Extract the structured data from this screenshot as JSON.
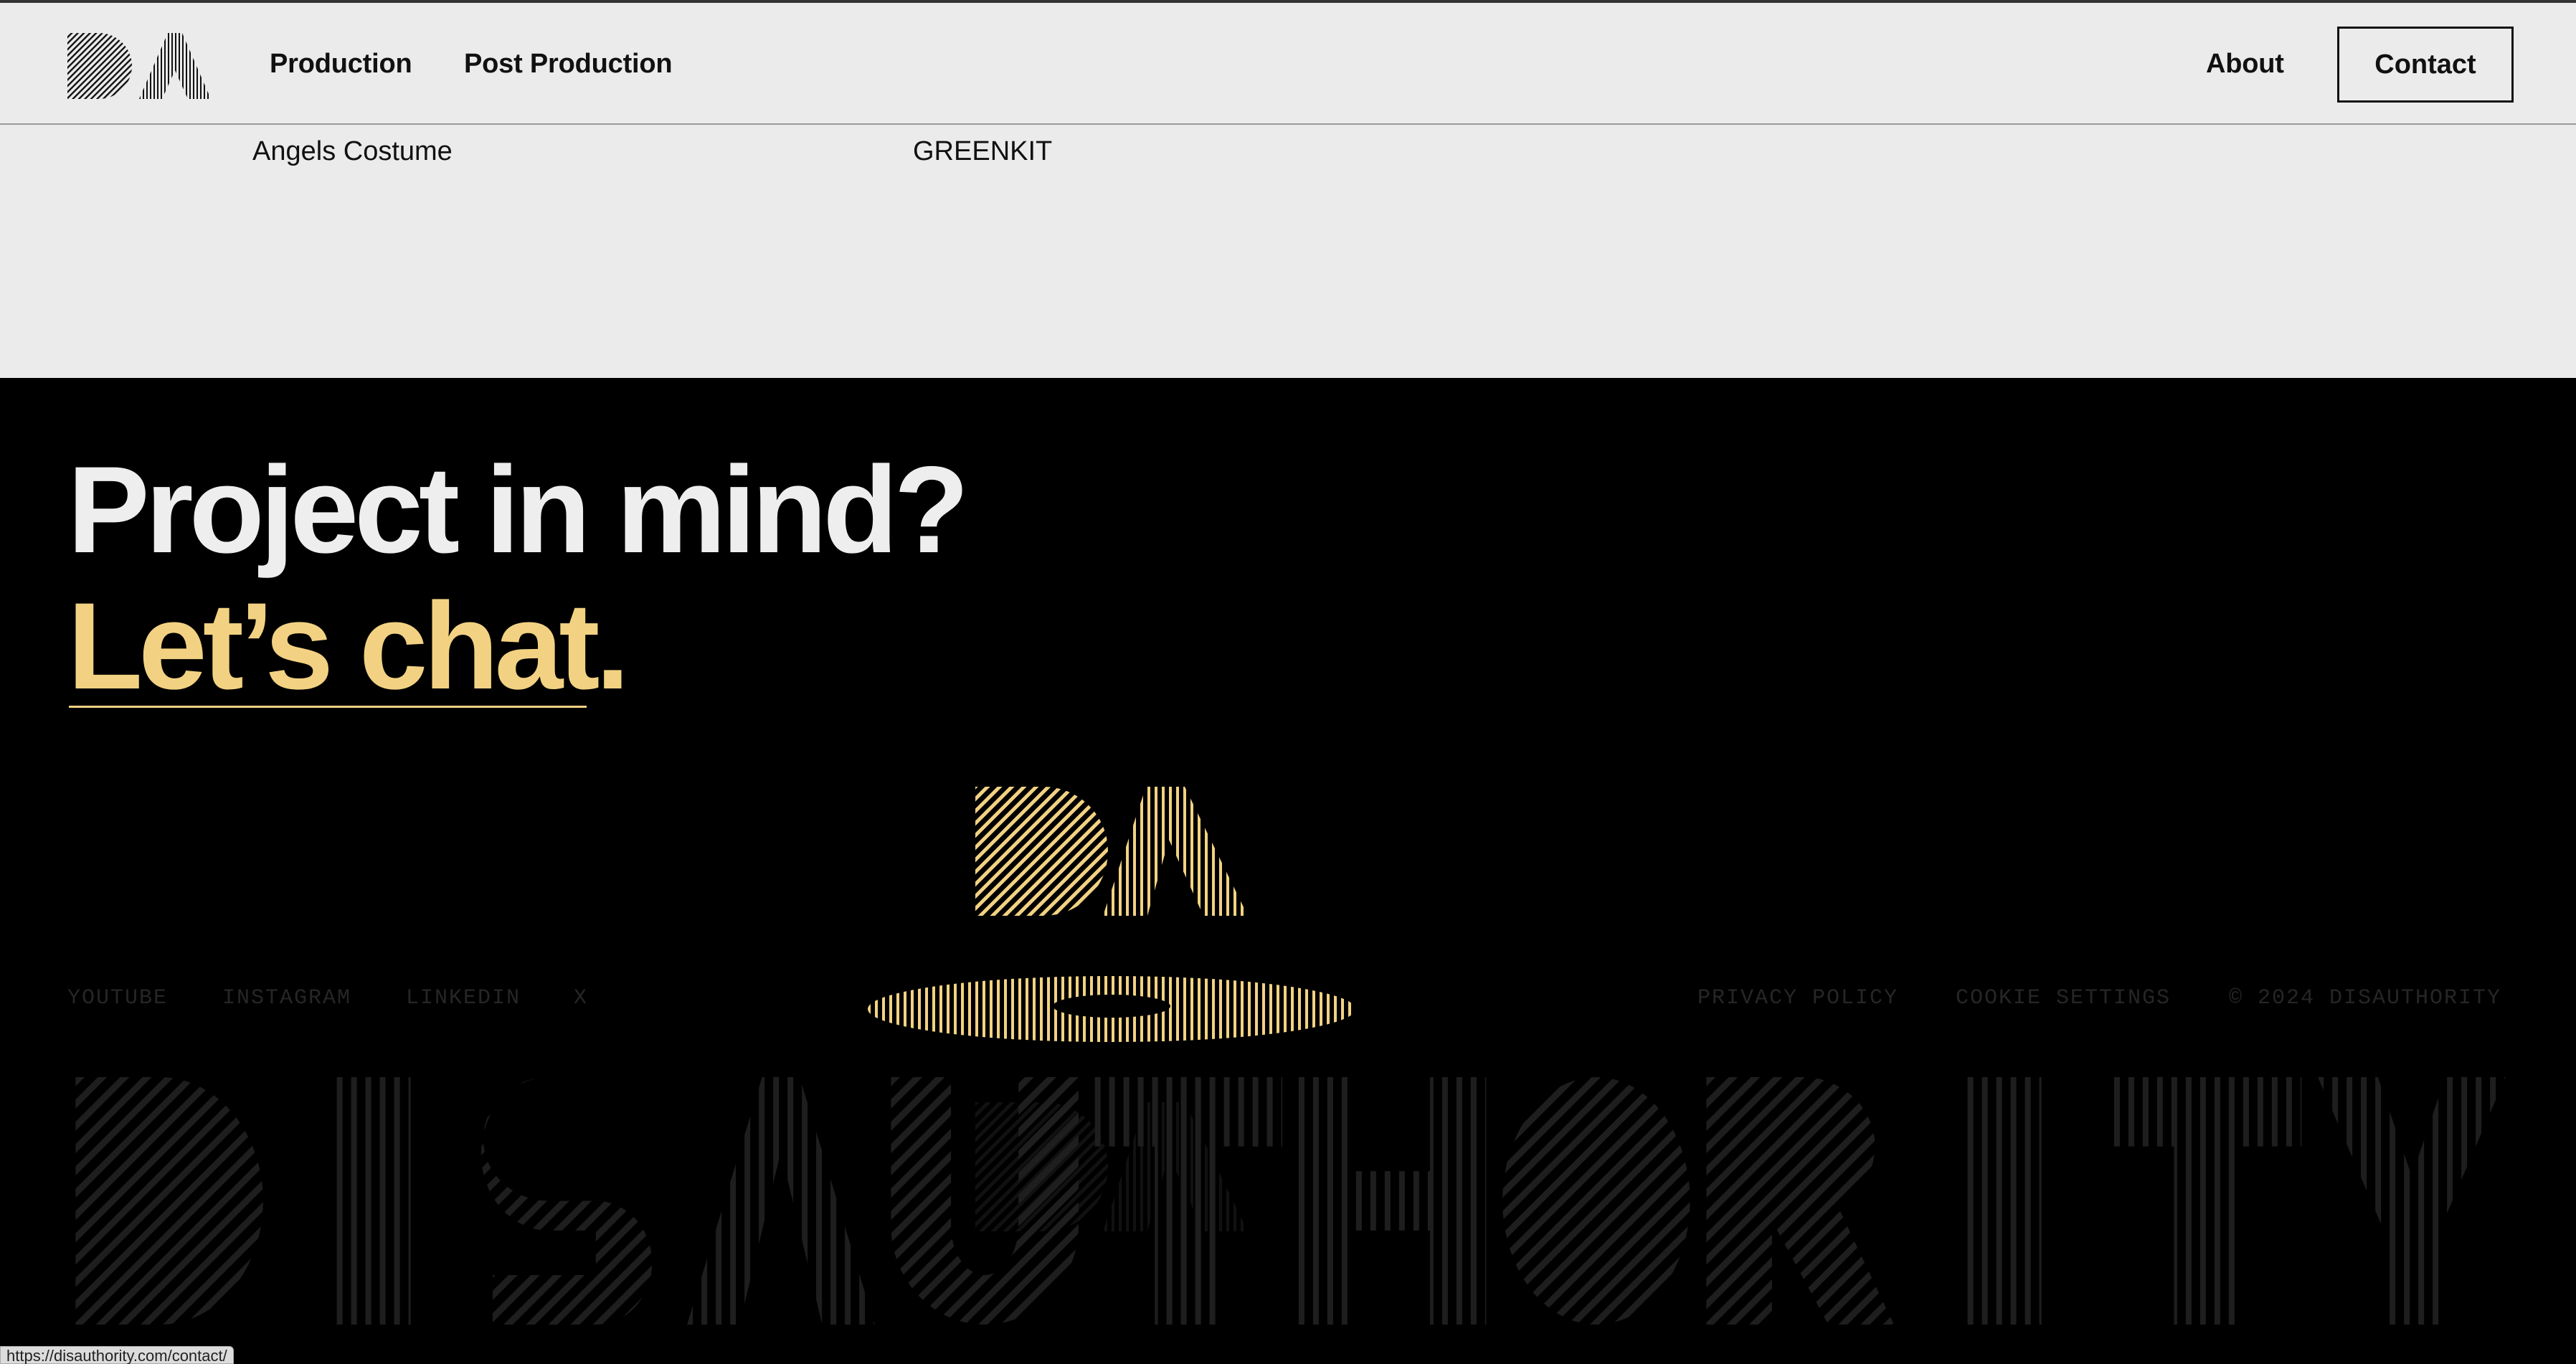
{
  "header": {
    "nav": {
      "production": "Production",
      "post_production": "Post Production",
      "about": "About",
      "contact": "Contact"
    }
  },
  "clients": [
    "Angels Costume",
    "GREENKIT"
  ],
  "footer": {
    "headline_line1": "Project in mind?",
    "headline_line2": "Let’s chat.",
    "social": [
      "YOUTUBE",
      "INSTAGRAM",
      "LINKEDIN",
      "X"
    ],
    "legal": {
      "privacy": "PRIVACY POLICY",
      "cookie": "COOKIE SETTINGS",
      "copyright": "© 2024 DISAUTHORITY"
    },
    "wordmark": "DISAUTHORITY"
  },
  "status_bar": {
    "url": "https://disauthority.com/contact/"
  },
  "colors": {
    "page_bg": "#ebebeb",
    "footer_bg": "#000000",
    "accent_gold": "#f2d282",
    "headline_white": "#eeeeee",
    "muted_footer_text": "#262626"
  },
  "icons": {
    "logo": "da-logo-icon",
    "emblem": "da-hat-emblem-icon"
  }
}
